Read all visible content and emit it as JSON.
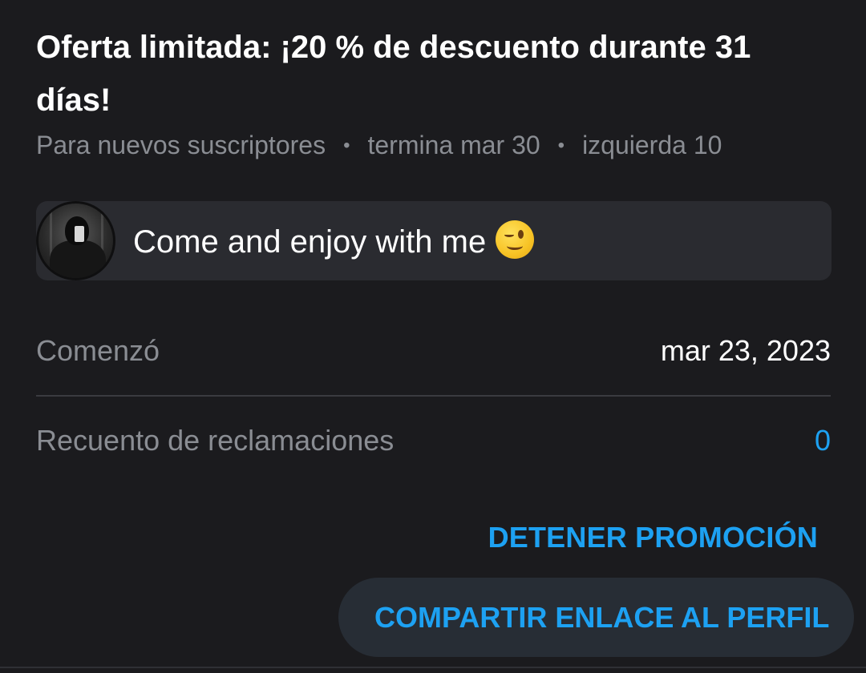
{
  "promotion": {
    "title": "Oferta limitada: ¡20 % de descuento durante 31 días!",
    "audience": "Para nuevos suscriptores",
    "ends": "termina mar 30",
    "remaining": "izquierda 10",
    "separator": "•"
  },
  "message": {
    "text": "Come and enjoy with me",
    "emoji": "winking-face-emoji"
  },
  "details": {
    "started_label": "Comenzó",
    "started_value": "mar 23, 2023",
    "claims_label": "Recuento de reclamaciones",
    "claims_value": "0"
  },
  "actions": {
    "stop_label": "DETENER PROMOCIÓN",
    "share_label": "COMPARTIR ENLACE AL PERFIL"
  },
  "colors": {
    "background": "#1b1b1e",
    "accent": "#1da1f2",
    "muted_text": "#8a8d93",
    "bubble": "#2a2b30"
  }
}
